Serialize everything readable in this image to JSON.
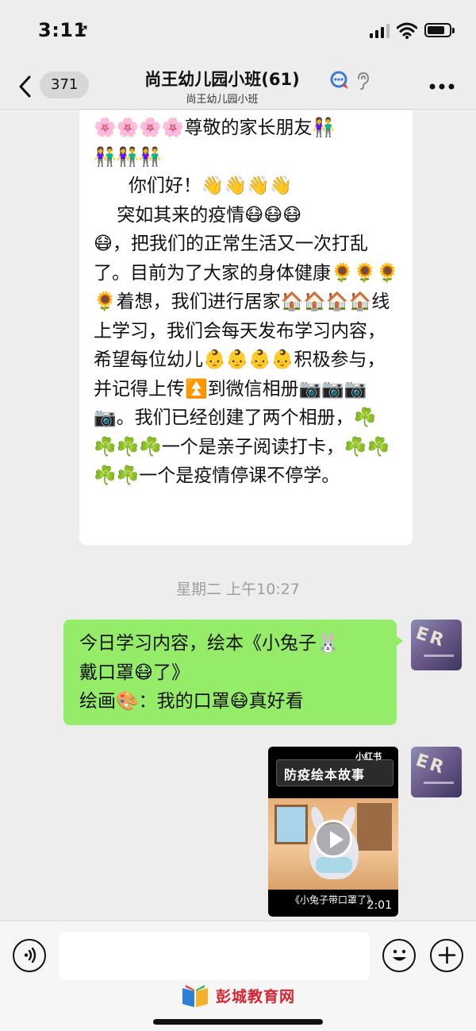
{
  "status_bar": {
    "time": "3:11",
    "location_icon": "location-arrow-icon",
    "signal_icon": "signal-bars-icon",
    "wifi_icon": "wifi-icon",
    "battery_icon": "battery-icon"
  },
  "nav": {
    "unread_count": "371",
    "title": "尚王幼儿园小班(61)",
    "subtitle": "尚王幼儿园小班",
    "back_icon": "chevron-left-icon",
    "group_icon": "group-chat-icon",
    "ear_icon": "ear-icon",
    "more_icon": "more-dots-icon"
  },
  "messages": {
    "incoming_text": "🌸🌸🌸🌸尊敬的家长朋友👫\n👫👫👫\n      你们好！👋👋👋👋\n    突如其来的疫情😷😷😷\n😷，把我们的正常生活又一次打乱了。目前为了大家的身体健康🌻🌻🌻🌻着想，我们进行居家🏠🏠🏠🏠线上学习，我们会每天发布学习内容，希望每位幼儿👶👶👶👶积极参与，并记得上传⏫到微信相册📷📷📷📷。我们已经创建了两个相册，☘️\n☘️☘️☘️一个是亲子阅读打卡，☘️☘️☘️☘️一个是疫情停课不停学。",
    "timestamp": "星期二 上午10:27",
    "outgoing_text": "今日学习内容，绘本《小兔子🐰\n戴口罩😷了》\n绘画🎨：我的口罩😷真好看"
  },
  "video": {
    "banner_title": "防疫绘本故事",
    "brand": "小红书",
    "caption": "《小兔子带口罩了》",
    "duration": "2:01"
  },
  "input_bar": {
    "voice_icon": "voice-icon",
    "emoji_icon": "emoji-icon",
    "plus_icon": "plus-icon"
  },
  "watermark": {
    "text": "彭城教育网"
  },
  "colors": {
    "background": "#ededed",
    "outgoing_bubble": "#95ec69",
    "incoming_bubble": "#ffffff",
    "timestamp": "#9e9e9e",
    "watermark": "#d3242f"
  }
}
